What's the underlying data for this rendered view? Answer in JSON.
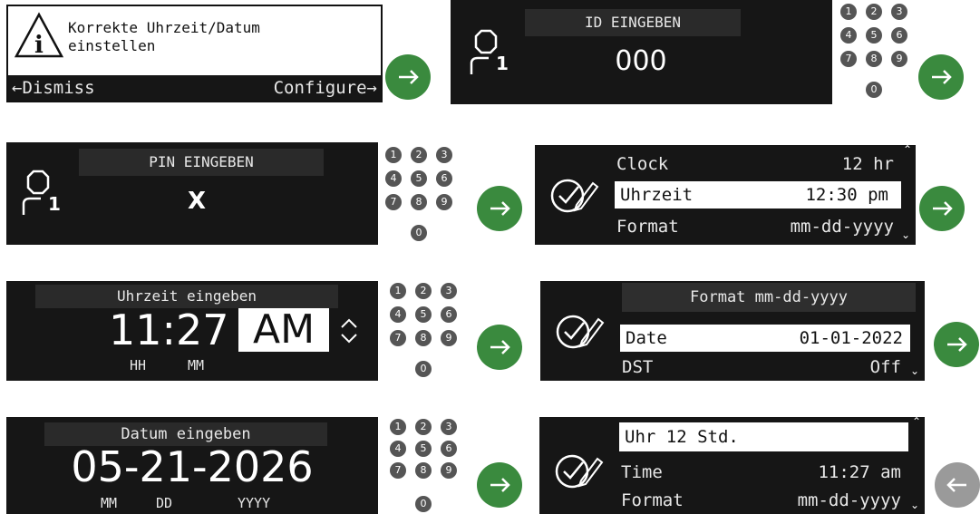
{
  "notice": {
    "text_line1": "Korrekte Uhrzeit/Datum",
    "text_line2": "einstellen",
    "dismiss": "Dismiss",
    "configure": "Configure"
  },
  "id_screen": {
    "title": "ID EINGEBEN",
    "value": "000",
    "user_num": "1"
  },
  "pin_screen": {
    "title": "PIN EINGEBEN",
    "value": "X",
    "user_num": "1"
  },
  "menu1": {
    "rows": [
      {
        "label": "Clock",
        "value": "12 hr"
      },
      {
        "label": "Uhrzeit",
        "value": "12:30 pm"
      },
      {
        "label": "Format",
        "value": "mm-dd-yyyy"
      }
    ]
  },
  "time_entry": {
    "title": "Uhrzeit eingeben",
    "value": "11:27",
    "ampm": "AM",
    "hh": "HH",
    "mm": "MM"
  },
  "menu2": {
    "title": "Format mm-dd-yyyy",
    "rows": [
      {
        "label": "Date",
        "value": "01-01-2022"
      },
      {
        "label": "DST",
        "value": "Off"
      }
    ]
  },
  "date_entry": {
    "title": "Datum eingeben",
    "value": "05-21-2026",
    "mm": "MM",
    "dd": "DD",
    "yyyy": "YYYY"
  },
  "menu3": {
    "header": "Uhr 12 Std.",
    "rows": [
      {
        "label": "Time",
        "value": "11:27 am"
      },
      {
        "label": "Format",
        "value": "mm-dd-yyyy"
      }
    ]
  },
  "keypad": {
    "keys": [
      "1",
      "2",
      "3",
      "4",
      "5",
      "6",
      "7",
      "8",
      "9",
      "0"
    ]
  },
  "icons": {
    "arrow": "arrow-right-icon",
    "info": "info-icon",
    "user": "user-icon",
    "check_edit": "check-edit-icon",
    "updown": "up-down-icon"
  }
}
